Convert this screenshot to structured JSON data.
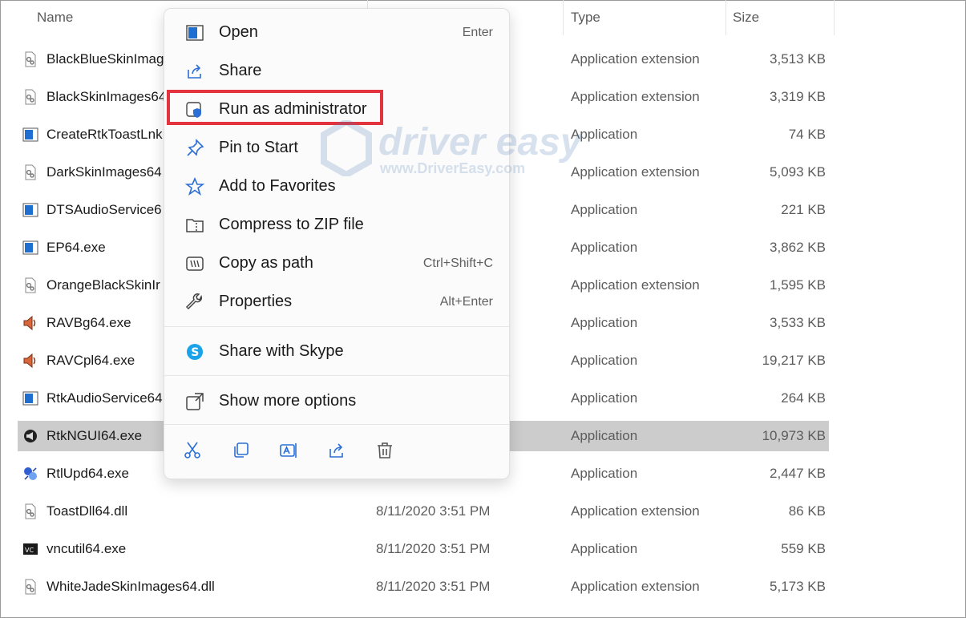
{
  "columns": {
    "name": "Name",
    "type": "Type",
    "size": "Size"
  },
  "files": [
    {
      "name": "BlackBlueSkinImag",
      "date": "",
      "type": "Application extension",
      "size": "3,513 KB",
      "icon": "dll-icon"
    },
    {
      "name": "BlackSkinImages64",
      "date": "",
      "type": "Application extension",
      "size": "3,319 KB",
      "icon": "dll-icon"
    },
    {
      "name": "CreateRtkToastLnk",
      "date": "",
      "type": "Application",
      "size": "74 KB",
      "icon": "exe-window-icon"
    },
    {
      "name": "DarkSkinImages64",
      "date": "",
      "type": "Application extension",
      "size": "5,093 KB",
      "icon": "dll-icon"
    },
    {
      "name": "DTSAudioService6",
      "date": "",
      "type": "Application",
      "size": "221 KB",
      "icon": "exe-window-icon"
    },
    {
      "name": "EP64.exe",
      "date": "",
      "type": "Application",
      "size": "3,862 KB",
      "icon": "exe-window-icon"
    },
    {
      "name": "OrangeBlackSkinIr",
      "date": "",
      "type": "Application extension",
      "size": "1,595 KB",
      "icon": "dll-icon"
    },
    {
      "name": "RAVBg64.exe",
      "date": "",
      "type": "Application",
      "size": "3,533 KB",
      "icon": "speaker-icon"
    },
    {
      "name": "RAVCpl64.exe",
      "date": "",
      "type": "Application",
      "size": "19,217 KB",
      "icon": "speaker-icon"
    },
    {
      "name": "RtkAudioService64",
      "date": "",
      "type": "Application",
      "size": "264 KB",
      "icon": "exe-window-icon"
    },
    {
      "name": "RtkNGUI64.exe",
      "date": "",
      "type": "Application",
      "size": "10,973 KB",
      "icon": "realtek-speaker-icon",
      "selected": true
    },
    {
      "name": "RtlUpd64.exe",
      "date": "",
      "type": "Application",
      "size": "2,447 KB",
      "icon": "updater-icon"
    },
    {
      "name": "ToastDll64.dll",
      "date": "8/11/2020 3:51 PM",
      "type": "Application extension",
      "size": "86 KB",
      "icon": "dll-icon"
    },
    {
      "name": "vncutil64.exe",
      "date": "8/11/2020 3:51 PM",
      "type": "Application",
      "size": "559 KB",
      "icon": "vnc-icon"
    },
    {
      "name": "WhiteJadeSkinImages64.dll",
      "date": "8/11/2020 3:51 PM",
      "type": "Application extension",
      "size": "5,173 KB",
      "icon": "dll-icon"
    }
  ],
  "context_menu": {
    "items": [
      {
        "label": "Open",
        "shortcut": "Enter",
        "icon": "open-window-icon"
      },
      {
        "label": "Share",
        "shortcut": "",
        "icon": "share-icon"
      },
      {
        "label": "Run as administrator",
        "shortcut": "",
        "icon": "shield-icon",
        "highlighted": true
      },
      {
        "label": "Pin to Start",
        "shortcut": "",
        "icon": "pin-icon"
      },
      {
        "label": "Add to Favorites",
        "shortcut": "",
        "icon": "star-icon"
      },
      {
        "label": "Compress to ZIP file",
        "shortcut": "",
        "icon": "zip-folder-icon"
      },
      {
        "label": "Copy as path",
        "shortcut": "Ctrl+Shift+C",
        "icon": "copy-path-icon"
      },
      {
        "label": "Properties",
        "shortcut": "Alt+Enter",
        "icon": "wrench-icon"
      }
    ],
    "skype": {
      "label": "Share with Skype",
      "icon": "skype-icon"
    },
    "more": {
      "label": "Show more options",
      "icon": "more-options-icon"
    },
    "toolbar": [
      "cut-icon",
      "copy-icon",
      "rename-icon",
      "share-icon",
      "delete-icon"
    ]
  },
  "watermark": {
    "title": "driver easy",
    "url": "www.DriverEasy.com"
  },
  "colors": {
    "accent": "#2b6fd6",
    "highlight_border": "#e2333f",
    "selected_row": "#cccccc"
  }
}
